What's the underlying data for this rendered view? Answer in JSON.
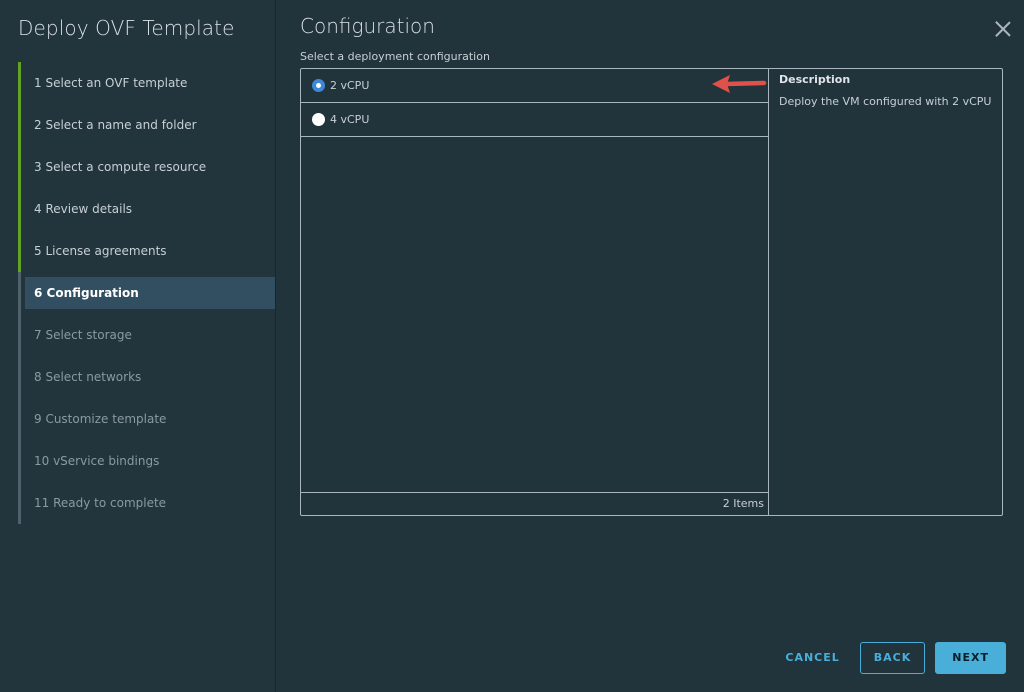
{
  "wizard": {
    "title": "Deploy OVF Template",
    "steps": [
      {
        "label": "1  Select an OVF template",
        "state": "done"
      },
      {
        "label": "2  Select a name and folder",
        "state": "done"
      },
      {
        "label": "3  Select a compute resource",
        "state": "done"
      },
      {
        "label": "4  Review details",
        "state": "done"
      },
      {
        "label": "5  License agreements",
        "state": "done"
      },
      {
        "label": "6  Configuration",
        "state": "active"
      },
      {
        "label": "7  Select storage",
        "state": "future"
      },
      {
        "label": "8  Select networks",
        "state": "future"
      },
      {
        "label": "9  Customize template",
        "state": "future"
      },
      {
        "label": "10  vService bindings",
        "state": "future"
      },
      {
        "label": "11  Ready to complete",
        "state": "future"
      }
    ]
  },
  "main": {
    "title": "Configuration",
    "subtitle": "Select a deployment configuration",
    "options": [
      {
        "label": "2 vCPU",
        "selected": true
      },
      {
        "label": "4 vCPU",
        "selected": false
      }
    ],
    "item_count": "2 Items",
    "description": {
      "heading": "Description",
      "text": "Deploy the VM configured with 2 vCPU"
    }
  },
  "buttons": {
    "cancel": "CANCEL",
    "back": "BACK",
    "next": "NEXT"
  },
  "colors": {
    "accent": "#49afd9",
    "done_step": "#62a420",
    "annotation_arrow": "#e0514a",
    "radio_selected": "#3d88d8"
  }
}
